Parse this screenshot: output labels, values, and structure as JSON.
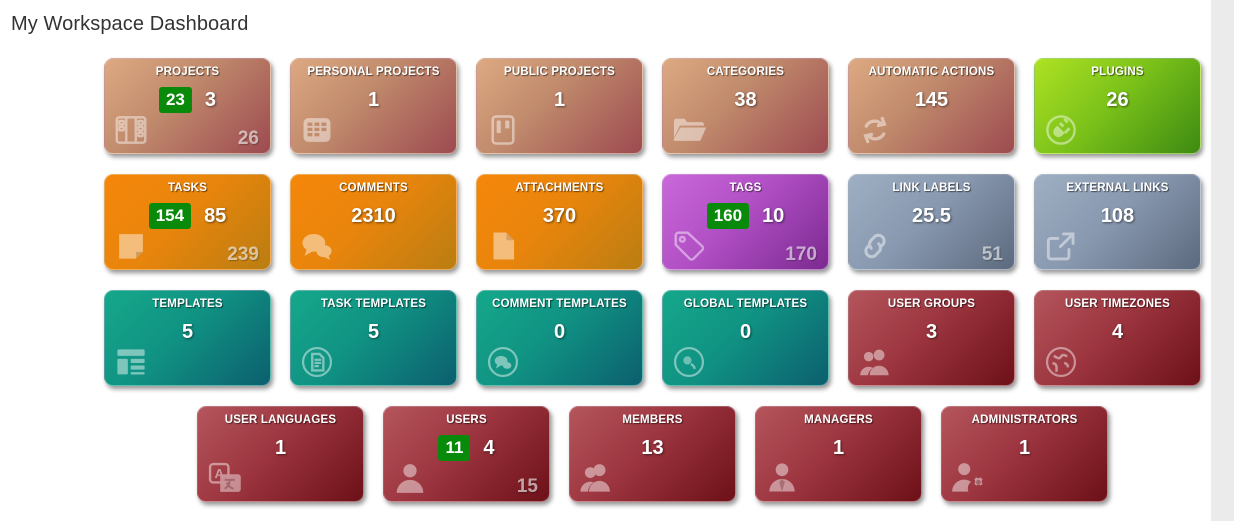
{
  "page": {
    "title": "My Workspace Dashboard",
    "background_color": "#ffffff",
    "outer_color": "#ebebeb",
    "badge_color": "#0a8a0a"
  },
  "rows": [
    {
      "offset": 104,
      "tiles": [
        {
          "title": "PROJECTS",
          "badge": "23",
          "value": "3",
          "corner": "26",
          "icon": "board-columns-icon",
          "color": "brown"
        },
        {
          "title": "PERSONAL PROJECTS",
          "badge": "",
          "value": "1",
          "corner": "",
          "icon": "grid-squares-icon",
          "color": "brown"
        },
        {
          "title": "PUBLIC PROJECTS",
          "badge": "",
          "value": "1",
          "corner": "",
          "icon": "kanban-icon",
          "color": "brown"
        },
        {
          "title": "CATEGORIES",
          "badge": "",
          "value": "38",
          "corner": "",
          "icon": "folder-icon",
          "color": "brown"
        },
        {
          "title": "AUTOMATIC ACTIONS",
          "badge": "",
          "value": "145",
          "corner": "",
          "icon": "recycle-arrows-icon",
          "color": "brown"
        },
        {
          "title": "PLUGINS",
          "badge": "",
          "value": "26",
          "corner": "",
          "icon": "plug-circle-icon",
          "color": "green"
        }
      ]
    },
    {
      "offset": 104,
      "tiles": [
        {
          "title": "TASKS",
          "badge": "154",
          "value": "85",
          "corner": "239",
          "icon": "note-icon",
          "color": "orange"
        },
        {
          "title": "COMMENTS",
          "badge": "",
          "value": "2310",
          "corner": "",
          "icon": "comments-icon",
          "color": "orange"
        },
        {
          "title": "ATTACHMENTS",
          "badge": "",
          "value": "370",
          "corner": "",
          "icon": "file-icon",
          "color": "orange"
        },
        {
          "title": "TAGS",
          "badge": "160",
          "value": "10",
          "corner": "170",
          "icon": "tags-icon",
          "color": "purple"
        },
        {
          "title": "LINK LABELS",
          "badge": "",
          "value": "25.5",
          "corner": "51",
          "icon": "link-chain-icon",
          "color": "slate"
        },
        {
          "title": "EXTERNAL LINKS",
          "badge": "",
          "value": "108",
          "corner": "",
          "icon": "external-link-icon",
          "color": "slate"
        }
      ]
    },
    {
      "offset": 104,
      "tiles": [
        {
          "title": "TEMPLATES",
          "badge": "",
          "value": "5",
          "corner": "",
          "icon": "layout-template-icon",
          "color": "teal"
        },
        {
          "title": "TASK TEMPLATES",
          "badge": "",
          "value": "5",
          "corner": "",
          "icon": "document-circle-icon",
          "color": "teal"
        },
        {
          "title": "COMMENT TEMPLATES",
          "badge": "",
          "value": "0",
          "corner": "",
          "icon": "comment-circle-icon",
          "color": "teal"
        },
        {
          "title": "GLOBAL TEMPLATES",
          "badge": "",
          "value": "0",
          "corner": "",
          "icon": "globe-circle-icon",
          "color": "teal"
        },
        {
          "title": "USER GROUPS",
          "badge": "",
          "value": "3",
          "corner": "",
          "icon": "users-group-icon",
          "color": "red"
        },
        {
          "title": "USER TIMEZONES",
          "badge": "",
          "value": "4",
          "corner": "",
          "icon": "globe-timezone-icon",
          "color": "red"
        }
      ]
    },
    {
      "offset": 197,
      "tiles": [
        {
          "title": "USER LANGUAGES",
          "badge": "",
          "value": "1",
          "corner": "",
          "icon": "translate-icon",
          "color": "red"
        },
        {
          "title": "USERS",
          "badge": "11",
          "value": "4",
          "corner": "15",
          "icon": "user-icon",
          "color": "red"
        },
        {
          "title": "MEMBERS",
          "badge": "",
          "value": "13",
          "corner": "",
          "icon": "user-members-icon",
          "color": "red"
        },
        {
          "title": "MANAGERS",
          "badge": "",
          "value": "1",
          "corner": "",
          "icon": "user-tie-icon",
          "color": "red"
        },
        {
          "title": "ADMINISTRATORS",
          "badge": "",
          "value": "1",
          "corner": "",
          "icon": "user-gear-icon",
          "color": "red"
        }
      ]
    }
  ]
}
